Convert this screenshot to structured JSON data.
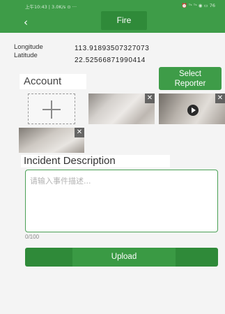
{
  "status_bar": {
    "left": "上午10:43 | 3.0K/s ⊙ ···",
    "right": "⏰ ᵀˢ ᵀˢ ◉ ▭ 76"
  },
  "header": {
    "back_icon": "chevron-left-icon",
    "title": "Fire"
  },
  "location": {
    "longitude_label": "Longitude",
    "longitude_value": "113.91893507327073",
    "latitude_label": "Latitude",
    "latitude_value": "22.52566871990414"
  },
  "account": {
    "label": "Account",
    "select_button_line1": "Select",
    "select_button_line2": "Reporter"
  },
  "media": {
    "add_icon": "plus-icon",
    "close_glyph": "✕"
  },
  "incident": {
    "label": "Incident Description",
    "placeholder": "请输入事件描述...",
    "value": "",
    "counter": "0/100"
  },
  "upload": {
    "label": "Upload"
  },
  "colors": {
    "primary": "#3e9c48",
    "primary_dark": "#2f8a39",
    "border_green": "#4aa055"
  }
}
